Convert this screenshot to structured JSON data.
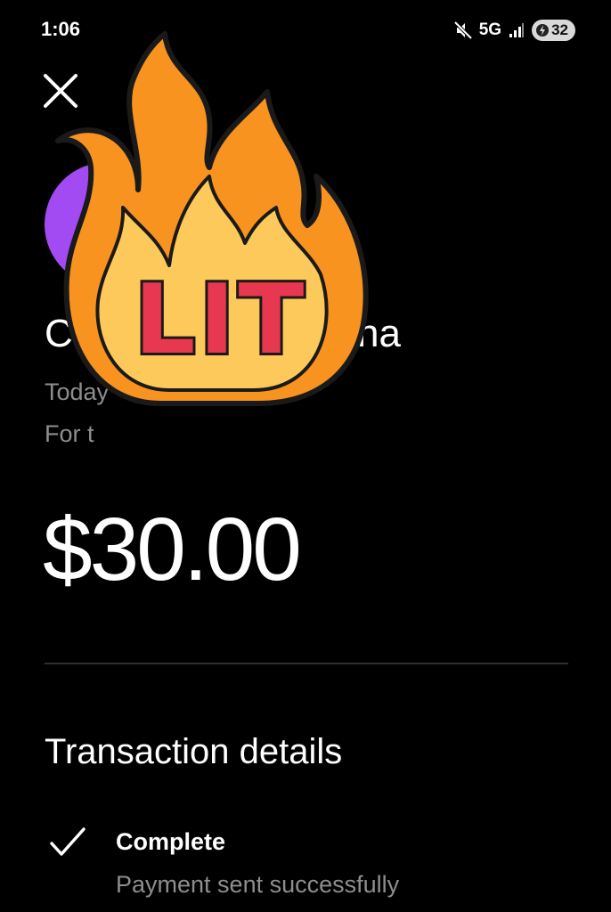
{
  "status_bar": {
    "time": "1:06",
    "network": "5G",
    "battery": "32",
    "icons": [
      "mute-icon",
      "signal-icon",
      "battery-saver-icon"
    ]
  },
  "header": {
    "close_icon": "close-icon"
  },
  "transaction": {
    "recipient_visible_start": "C",
    "recipient_visible_end": "dina",
    "date_visible": "Today",
    "note_visible": "For t",
    "amount": "$30.00"
  },
  "details": {
    "title": "Transaction details",
    "status_label": "Complete",
    "status_description": "Payment sent successfully",
    "status_icon": "checkmark-icon"
  },
  "sticker": {
    "text": "LIT",
    "icon": "fire-icon",
    "colors": {
      "outer": "#f7931e",
      "inner": "#fdc95a",
      "text": "#e8384f",
      "outline": "#1a1a1a"
    }
  },
  "colors": {
    "background": "#000000",
    "avatar": "#a24bf2",
    "secondary_text": "#8e8e8e"
  }
}
